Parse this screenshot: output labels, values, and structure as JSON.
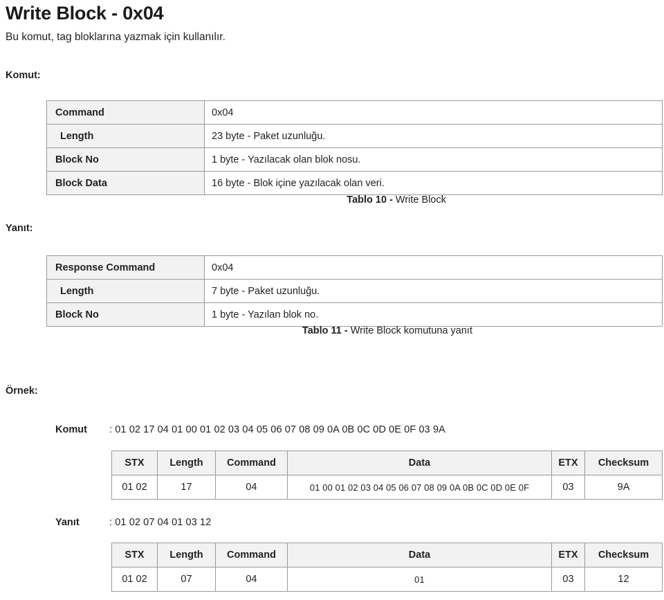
{
  "document": {
    "title": "Write Block - 0x04",
    "intro": "Bu komut, tag bloklarına yazmak için kullanılır.",
    "command_label": "Komut:",
    "response_label": "Yanıt:",
    "example_label": "Örnek:"
  },
  "command_table": {
    "rows": [
      {
        "key": "Command",
        "value": "0x04"
      },
      {
        "key": "Length",
        "value": "23 byte - Paket uzunluğu."
      },
      {
        "key": "Block No",
        "value": "1 byte - Yazılacak olan blok nosu."
      },
      {
        "key": "Block Data",
        "value": "16 byte - Blok içine yazılacak olan veri."
      }
    ],
    "caption_bold": "Tablo 10 -",
    "caption_rest": " Write Block"
  },
  "response_table": {
    "rows": [
      {
        "key": "Response Command",
        "value": "0x04"
      },
      {
        "key": "Length",
        "value": "7 byte - Paket uzunluğu."
      },
      {
        "key": "Block No",
        "value": "1 byte - Yazılan blok no."
      }
    ],
    "caption_bold": "Tablo 11 -",
    "caption_rest": " Write Block komutuna yanıt"
  },
  "example": {
    "command": {
      "label": "Komut",
      "value": ": 01 02 17 04 01 00 01 02 03 04 05 06 07 08 09 0A 0B 0C 0D 0E 0F 03 9A",
      "headers": [
        "STX",
        "Length",
        "Command",
        "Data",
        "ETX",
        "Checksum"
      ],
      "values": [
        "01 02",
        "17",
        "04",
        "01 00 01 02 03 04 05 06 07 08 09 0A 0B 0C 0D 0E 0F",
        "03",
        "9A"
      ]
    },
    "response": {
      "label": "Yanıt",
      "value": ": 01 02 07 04 01 03 12",
      "headers": [
        "STX",
        "Length",
        "Command",
        "Data",
        "ETX",
        "Checksum"
      ],
      "values": [
        "01 02",
        "07",
        "04",
        "01",
        "03",
        "12"
      ]
    }
  },
  "colors": {
    "text": "#231f20",
    "table_border": "#9a9a9a",
    "header_fill": "#f2f2f2",
    "page_background": "#ffffff"
  }
}
